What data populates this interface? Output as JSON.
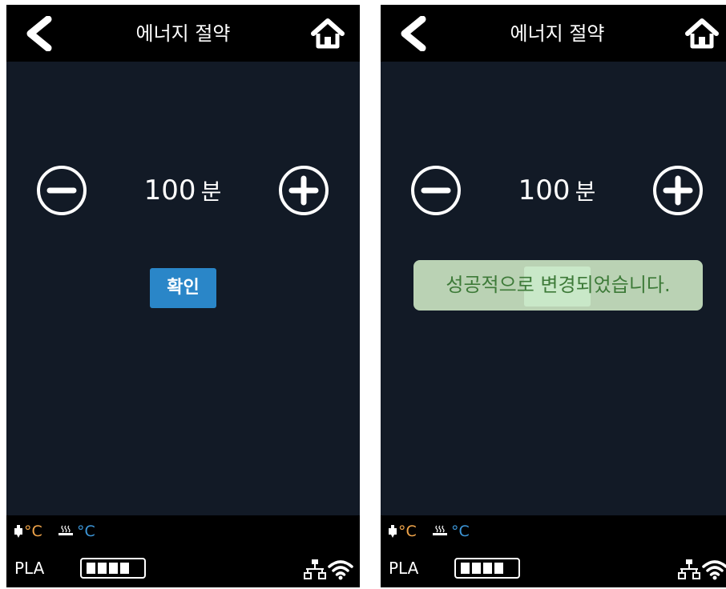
{
  "colors": {
    "panel_bg": "#121a26",
    "bar_bg": "#000000",
    "accent_blue": "#2a86c8",
    "nozzle_orange": "#f2a64b",
    "bed_blue": "#3d97d9",
    "toast_bg": "#d2ecc8",
    "toast_text": "#3d7a38"
  },
  "left": {
    "header": {
      "title": "에너지 절약",
      "back_icon": "chevron-left-icon",
      "home_icon": "home-icon"
    },
    "stepper": {
      "value": "100",
      "unit": "분",
      "minus_icon": "minus-circle-icon",
      "plus_icon": "plus-circle-icon"
    },
    "confirm_label": "확인",
    "status": {
      "nozzle_temp": "°C",
      "bed_temp": "°C",
      "material": "PLA",
      "battery_level": 1.0,
      "ethernet_icon": "ethernet-icon",
      "wifi_icon": "wifi-icon"
    }
  },
  "right": {
    "header": {
      "title": "에너지 절약",
      "back_icon": "chevron-left-icon",
      "home_icon": "home-icon"
    },
    "stepper": {
      "value": "100",
      "unit": "분",
      "minus_icon": "minus-circle-icon",
      "plus_icon": "plus-circle-icon"
    },
    "toast_message": "성공적으로 변경되었습니다.",
    "status": {
      "nozzle_temp": "°C",
      "bed_temp": "°C",
      "material": "PLA",
      "battery_level": 1.0,
      "ethernet_icon": "ethernet-icon",
      "wifi_icon": "wifi-icon"
    }
  }
}
